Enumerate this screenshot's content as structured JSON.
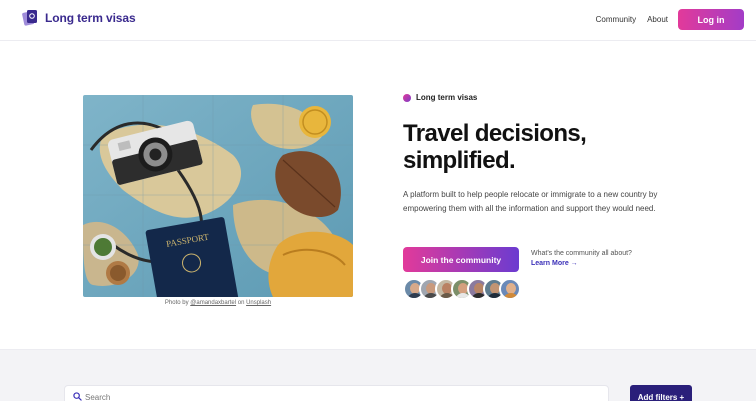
{
  "header": {
    "logo_text": "Long term visas",
    "nav": {
      "community": "Community",
      "about": "About"
    },
    "login_label": "Log in"
  },
  "hero": {
    "kicker": "Long term visas",
    "headline_line1": "Travel decisions,",
    "headline_line2": "simplified.",
    "description": "A platform built to help people relocate or immigrate to a new country by empowering them with all the information and support they would need.",
    "join_label": "Join the community",
    "whats_label": "What's the community all about?",
    "learn_more_label": "Learn More →",
    "photo": {
      "caption_prefix": "Photo by ",
      "caption_author": "@amandaxbartel",
      "caption_middle": " on ",
      "caption_source": "Unsplash",
      "passport_text": "PASSPORT"
    },
    "avatars": [
      {
        "name": "avatar-1"
      },
      {
        "name": "avatar-2"
      },
      {
        "name": "avatar-3"
      },
      {
        "name": "avatar-4"
      },
      {
        "name": "avatar-5"
      },
      {
        "name": "avatar-6"
      },
      {
        "name": "avatar-7"
      }
    ]
  },
  "filters": {
    "search_placeholder": "Search",
    "add_filters_label": "Add filters +"
  },
  "colors": {
    "brand_dark": "#3a2a8e",
    "accent_pink": "#e23a9a",
    "accent_purple": "#6b3bd0",
    "filters_button": "#2a1f7a"
  }
}
